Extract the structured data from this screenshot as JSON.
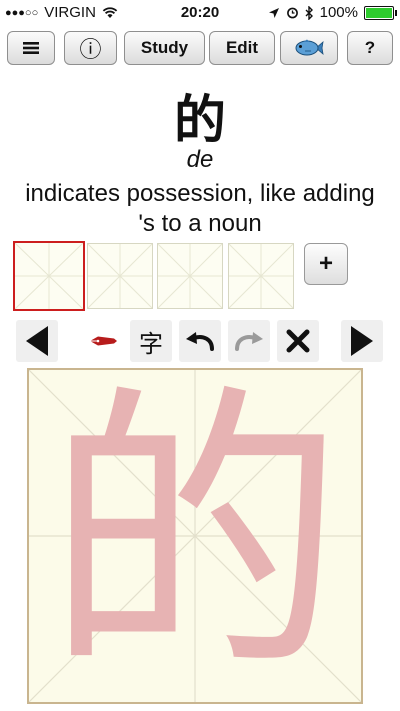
{
  "status_bar": {
    "signal_dots": "●●●○○",
    "carrier": "VIRGIN",
    "time": "20:20",
    "battery": "100%",
    "battery_level": 1.0
  },
  "toolbar": {
    "menu_icon": "menu-icon",
    "info_icon": "info-icon",
    "info_label": "ⓘ",
    "study_label": "Study",
    "edit_label": "Edit",
    "fish_icon": "fish-icon",
    "help_label": "?"
  },
  "card": {
    "character": "的",
    "pinyin": "de",
    "meaning": "indicates possession, like adding 's to a noun"
  },
  "practice": {
    "add_label": "+"
  },
  "drawing_tools": {
    "char_label": "字",
    "colors": {
      "pen": "#b71c1c",
      "disabled": "#9a9a9a"
    }
  },
  "writing_area": {
    "guide_character": "的",
    "colors": {
      "guide": "#e7b3b3",
      "border": "#c9b58f",
      "background": "#fcfbe9"
    }
  }
}
